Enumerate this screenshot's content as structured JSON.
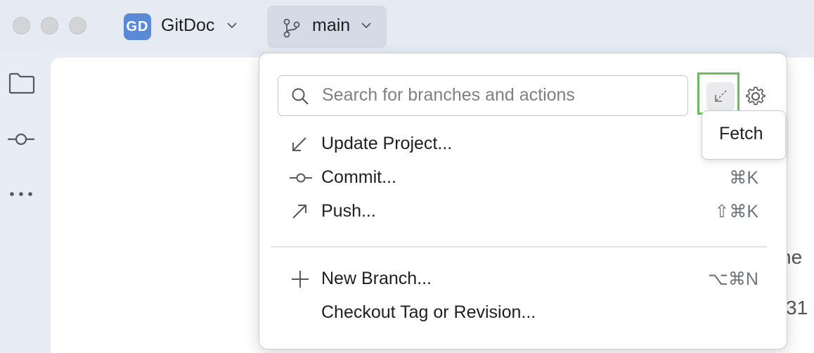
{
  "window": {
    "project_badge": "GD",
    "project_name": "GitDoc",
    "branch_name": "main"
  },
  "popup": {
    "search_placeholder": "Search for branches and actions",
    "fetch_tooltip": "Fetch",
    "actions": [
      {
        "label": "Update Project...",
        "shortcut": "",
        "icon": "update-arrow-icon"
      },
      {
        "label": "Commit...",
        "shortcut": "⌘K",
        "icon": "commit-icon"
      },
      {
        "label": "Push...",
        "shortcut": "⇧⌘K",
        "icon": "push-arrow-icon"
      }
    ],
    "branch_actions": [
      {
        "label": "New Branch...",
        "shortcut": "⌥⌘N",
        "icon": "plus-icon"
      },
      {
        "label": "Checkout Tag or Revision...",
        "shortcut": "",
        "icon": ""
      }
    ]
  },
  "background": {
    "partial_text_1": "he",
    "partial_text_2": "31"
  },
  "colors": {
    "accent_highlight": "#6bbb5e",
    "project_badge": "#5a8ad6"
  }
}
